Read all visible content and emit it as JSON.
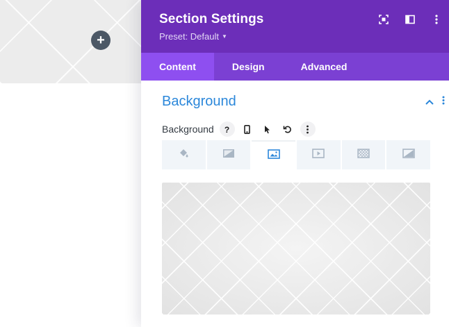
{
  "panel": {
    "title": "Section Settings",
    "preset": "Preset: Default",
    "header_icons": [
      "fullscreen-icon",
      "split-view-icon",
      "more-icon"
    ]
  },
  "tabs": [
    {
      "label": "Content",
      "active": true
    },
    {
      "label": "Design",
      "active": false
    },
    {
      "label": "Advanced",
      "active": false
    }
  ],
  "section": {
    "title": "Background",
    "icons": [
      "chevron-up-icon",
      "more-icon"
    ]
  },
  "field": {
    "label": "Background",
    "icons": [
      "help-icon",
      "mobile-icon",
      "cursor-icon",
      "reset-icon",
      "more-icon"
    ]
  },
  "background_types": [
    {
      "icon": "paint-bucket-icon",
      "active": false
    },
    {
      "icon": "gradient-icon",
      "active": false
    },
    {
      "icon": "image-icon",
      "active": true
    },
    {
      "icon": "video-icon",
      "active": false
    },
    {
      "icon": "pattern-icon",
      "active": false
    },
    {
      "icon": "mask-icon",
      "active": false
    }
  ],
  "canvas": {
    "add_button": "+"
  },
  "colors": {
    "header": "#6c2eb9",
    "tabs": "#7b40d3",
    "active_tab": "#8e4ff0",
    "accent": "#2b87da"
  }
}
